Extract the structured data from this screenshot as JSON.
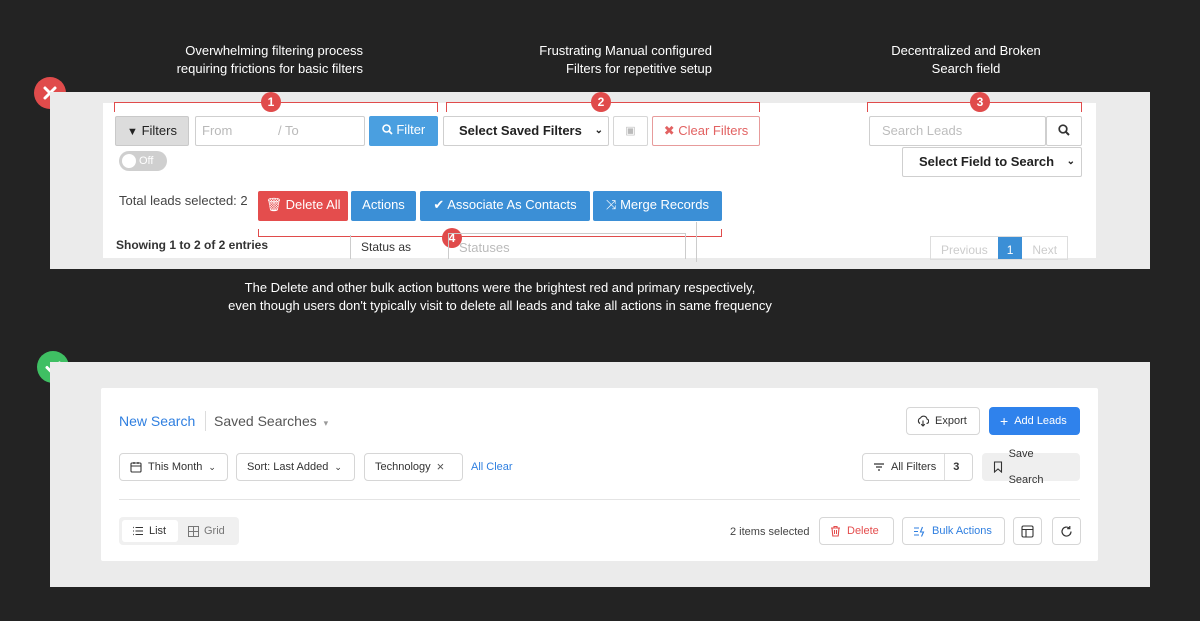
{
  "captions": {
    "c1_line1": "Overwhelming filtering process",
    "c1_line2": "requiring frictions for basic filters",
    "c2_line1": "Frustrating Manual configured",
    "c2_line2": "Filters for repetitive setup",
    "c3_line1": "Decentralized and Broken",
    "c3_line2": "Search field",
    "bottom_line1": "The Delete and other bulk action buttons were the brightest red and primary respectively,",
    "bottom_line2": "even though users don't typically visit to delete all leads and take all actions in same frequency"
  },
  "markers": [
    "1",
    "2",
    "3",
    "4"
  ],
  "old_ui": {
    "filters_btn": "Filters",
    "date_from": "From",
    "date_to": "/ To",
    "filter_btn": "Filter",
    "saved_filters_select": "Select Saved Filters",
    "clear_filters_btn": "Clear Filters",
    "toggle": "Off",
    "search_placeholder": "Search Leads",
    "field_select": "Select Field to Search",
    "total_selected": "Total leads selected: 2",
    "delete_all": "Delete All",
    "actions": "Actions",
    "associate": "Associate As Contacts",
    "merge": "Merge Records",
    "showing": "Showing 1 to 2 of 2 entries",
    "status_as": "Status as",
    "statuses": "Statuses",
    "pager_prev": "Previous",
    "pager_cur": "1",
    "pager_next": "Next"
  },
  "new_ui": {
    "new_search": "New Search",
    "saved_searches": "Saved Searches",
    "export": "Export",
    "add_leads": "Add Leads",
    "this_month": "This Month",
    "sort": "Sort: Last Added",
    "tag_technology": "Technology",
    "all_clear": "All Clear",
    "all_filters": "All Filters",
    "filter_count": "3",
    "save_search": "Save Search",
    "view_list": "List",
    "view_grid": "Grid",
    "items_selected": "2 items selected",
    "delete": "Delete",
    "bulk_actions": "Bulk Actions"
  },
  "colors": {
    "bad": "#e04b4b",
    "good": "#3fbf63",
    "primary": "#2f82ec"
  },
  "icons": [
    "close-icon",
    "check-icon",
    "funnel-icon",
    "search-icon",
    "save-icon",
    "times-icon",
    "trash-icon",
    "checkmark-icon",
    "shuffle-icon",
    "calendar-icon",
    "chevron-down-icon",
    "download-icon",
    "plus-icon",
    "filter-lines-icon",
    "bookmark-icon",
    "list-icon",
    "grid-icon",
    "bulk-icon",
    "table-icon",
    "refresh-icon"
  ]
}
